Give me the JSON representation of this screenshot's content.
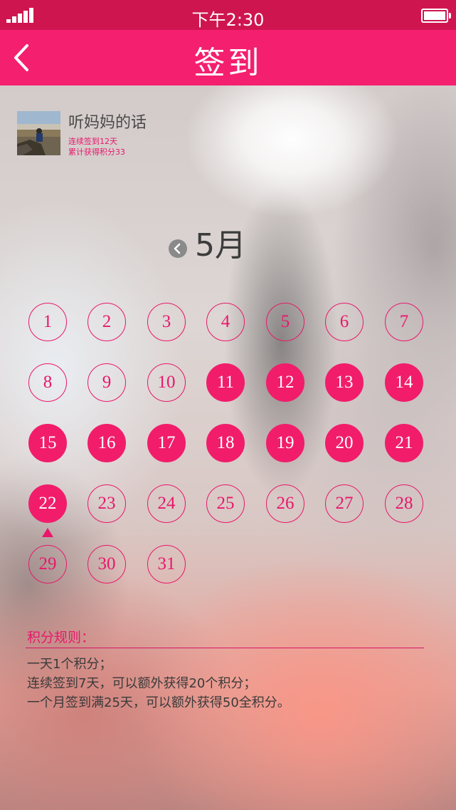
{
  "status": {
    "time": "下午2:30"
  },
  "nav": {
    "title": "签到",
    "back_icon": "chevron-left-icon"
  },
  "user": {
    "name": "听妈妈的话",
    "streak": "连续签到12天",
    "total": "累计获得积分33"
  },
  "calendar": {
    "month": "5月",
    "prev_icon": "chevron-left-icon",
    "days": [
      {
        "label": "1",
        "signed": false
      },
      {
        "label": "2",
        "signed": false
      },
      {
        "label": "3",
        "signed": false
      },
      {
        "label": "4",
        "signed": false
      },
      {
        "label": "5",
        "signed": false
      },
      {
        "label": "6",
        "signed": false
      },
      {
        "label": "7",
        "signed": false
      },
      {
        "label": "8",
        "signed": false
      },
      {
        "label": "9",
        "signed": false
      },
      {
        "label": "10",
        "signed": false
      },
      {
        "label": "11",
        "signed": true
      },
      {
        "label": "12",
        "signed": true
      },
      {
        "label": "13",
        "signed": true
      },
      {
        "label": "14",
        "signed": true
      },
      {
        "label": "15",
        "signed": true
      },
      {
        "label": "16",
        "signed": true
      },
      {
        "label": "17",
        "signed": true
      },
      {
        "label": "18",
        "signed": true
      },
      {
        "label": "19",
        "signed": true
      },
      {
        "label": "20",
        "signed": true
      },
      {
        "label": "21",
        "signed": true
      },
      {
        "label": "22",
        "signed": true,
        "today": true
      },
      {
        "label": "23",
        "signed": false
      },
      {
        "label": "24",
        "signed": false
      },
      {
        "label": "25",
        "signed": false
      },
      {
        "label": "26",
        "signed": false
      },
      {
        "label": "27",
        "signed": false
      },
      {
        "label": "28",
        "signed": false
      },
      {
        "label": "29",
        "signed": false
      },
      {
        "label": "30",
        "signed": false
      },
      {
        "label": "31",
        "signed": false
      }
    ]
  },
  "rules": {
    "title": "积分规则：",
    "items": [
      "一天1个积分；",
      "连续签到7天，可以额外获得20个积分；",
      "一个月签到满25天，可以额外获得50全积分。"
    ]
  },
  "colors": {
    "accent": "#f41f6f",
    "statusbar": "#cf1550"
  }
}
